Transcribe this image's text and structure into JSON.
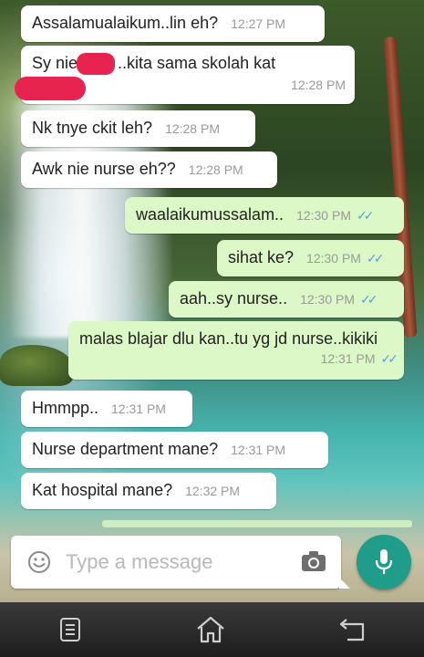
{
  "chat": {
    "messages": [
      {
        "direction": "in",
        "text": "Assalamualaikum..lin eh?",
        "time": "12:27 PM"
      },
      {
        "direction": "in",
        "text_before": "Sy nie",
        "text_after": "..kita sama skolah kat",
        "time": "12:28 PM"
      },
      {
        "direction": "in",
        "text": "Nk tnye ckit leh?",
        "time": "12:28 PM"
      },
      {
        "direction": "in",
        "text": "Awk nie nurse eh??",
        "time": "12:28 PM"
      },
      {
        "direction": "out",
        "text": "waalaikumussalam..",
        "time": "12:30 PM",
        "status": "read"
      },
      {
        "direction": "out",
        "text": "sihat ke?",
        "time": "12:30 PM",
        "status": "read"
      },
      {
        "direction": "out",
        "text": "aah..sy nurse..",
        "time": "12:30 PM",
        "status": "read"
      },
      {
        "direction": "out",
        "text": "malas blajar dlu kan..tu yg jd nurse..kikiki",
        "time": "12:31 PM",
        "status": "read"
      },
      {
        "direction": "in",
        "text": "Hmmpp..",
        "time": "12:31 PM"
      },
      {
        "direction": "in",
        "text": "Nurse department mane?",
        "time": "12:31 PM"
      },
      {
        "direction": "in",
        "text": "Kat hospital mane?",
        "time": "12:32 PM"
      }
    ]
  },
  "composer": {
    "placeholder": "Type a message",
    "emoji_icon": "emoji-icon",
    "camera_icon": "camera-icon",
    "mic_icon": "mic-icon"
  },
  "navbar": {
    "menu_icon": "menu-icon",
    "home_icon": "home-icon",
    "back_icon": "back-icon"
  },
  "colors": {
    "incoming_bubble": "#ffffff",
    "outgoing_bubble": "#dcf8c6",
    "read_ticks": "#4fa3e0",
    "accent": "#1f9c8a",
    "redaction": "#e8234f"
  }
}
